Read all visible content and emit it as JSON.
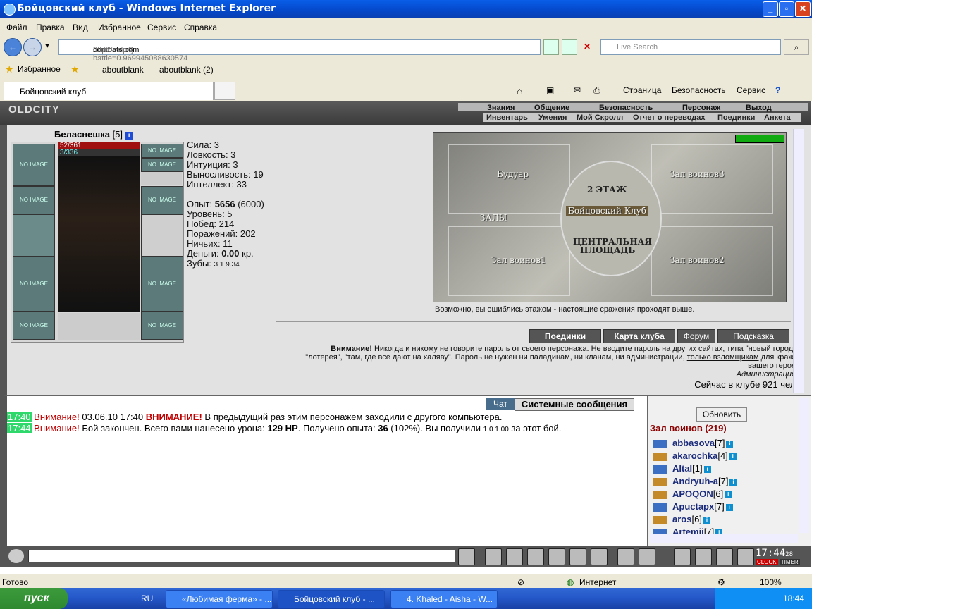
{
  "window": {
    "title": "Бойцовский клуб - Windows Internet Explorer"
  },
  "menu": [
    "Файл",
    "Правка",
    "Вид",
    "Избранное",
    "Сервис",
    "Справка"
  ],
  "address": {
    "prefix": "http://oldcity.",
    "domain": "combats.com",
    "suffix": "/buttons.pl?battle=0.969945088630574",
    "search_placeholder": "Live Search"
  },
  "favorites": {
    "label": "Избранное",
    "links": [
      "aboutblank",
      "aboutblank (2)"
    ]
  },
  "tab": {
    "title": "Бойцовский клуб"
  },
  "command_bar": {
    "page": "Страница",
    "security": "Безопасность",
    "service": "Сервис"
  },
  "game": {
    "logo": "OLDCITY",
    "top_menu": [
      "Знания",
      "Общение",
      "Безопасность",
      "Персонаж",
      "Выход"
    ],
    "sub_menu": [
      "Инвентарь",
      "Умения",
      "Мой Скролл",
      "Отчет о переводах",
      "Поединки",
      "Анкета"
    ],
    "player": {
      "name": "Беласнешка",
      "level": "[5]",
      "hp": "52/361",
      "mp": "3/336",
      "no_image": "NO IMAGE"
    },
    "stats": {
      "strength": "Сила: 3",
      "agility": "Ловкость: 3",
      "intuition": "Интуиция: 3",
      "endurance": "Выносливость: 19",
      "intellect": "Интеллект: 33",
      "exp_label": "Опыт: ",
      "exp_value": "5656",
      "exp_next": " (6000)",
      "level": "Уровень: 5",
      "wins": "Побед: 214",
      "losses": "Поражений: 202",
      "draws": "Ничьих: 11",
      "money_label": "Деньги: ",
      "money_value": "0.00",
      "money_unit": " кр.",
      "teeth_label": "Зубы: ",
      "teeth_values": "3  1  9.34"
    },
    "map": {
      "rooms": [
        "Будуар",
        "Зал воинов3",
        "2 ЭТАЖ",
        "Бойцовский Клуб",
        "ЗАЛЫ",
        "Зал воинов1",
        "Зал воинов2"
      ],
      "central_1": "ЦЕНТРАЛЬНАЯ",
      "central_2": "ПЛОЩАДЬ",
      "note": "Возможно, вы ошиблись этажом - настоящие сражения проходят выше."
    },
    "buttons": [
      "Поединки",
      "Карта клуба",
      "Форум",
      "Подсказка"
    ],
    "warning": {
      "bold": "Внимание!",
      "text": " Никогда и никому не говорите пароль от своего персонажа. Не вводите пароль на других сайтах, типа \"новый город\", \"лотерея\", \"там, где все дают на халяву\". Пароль не нужен ни паладинам, ни кланам, ни администрации, ",
      "link": "только взломщикам",
      "tail": " для кражи вашего героя.",
      "sign": "Администрация."
    },
    "online": "Сейчас в клубе 921 чел."
  },
  "chat": {
    "tabs": [
      "Чат",
      "Системные сообщения"
    ],
    "messages": [
      {
        "time": "17:40",
        "prefix": "Внимание!",
        "text1": " 03.06.10 17:40 ",
        "bold": "ВНИМАНИЕ!",
        "text2": " В предыдущий раз этим персонажем заходили с другого компьютера."
      },
      {
        "time": "17:44",
        "prefix": "Внимание!",
        "text1": " Бой закончен. Всего вами нанесено урона: ",
        "dmg": "129 HP",
        "text2": ". Получено опыта: ",
        "exp": "36",
        "text3": " (102%). Вы получили ",
        "reward": "1  0  1.00",
        "text4": " за этот бой."
      }
    ]
  },
  "users": {
    "refresh": "Обновить",
    "room": "Зал воинов (219)",
    "list": [
      {
        "name": "abbasova",
        "lvl": "[7]"
      },
      {
        "name": "akarochka",
        "lvl": "[4]"
      },
      {
        "name": "Altal",
        "lvl": "[1]"
      },
      {
        "name": "Andryuh-a",
        "lvl": "[7]"
      },
      {
        "name": "APOQON",
        "lvl": "[6]"
      },
      {
        "name": "Apuctapx",
        "lvl": "[7]"
      },
      {
        "name": "aros",
        "lvl": "[6]"
      },
      {
        "name": "Artemii",
        "lvl": "[7]"
      }
    ]
  },
  "clock": {
    "time": "17:44",
    "sec": "28",
    "tab1": "CLOCK",
    "tab2": "TIMER"
  },
  "status": {
    "left": "Готово",
    "zone": "Интернет",
    "zoom": "100%"
  },
  "taskbar": {
    "start": "пуск",
    "lang": "RU",
    "tasks": [
      "«Любимая ферма» - ...",
      "Бойцовский клуб - ...",
      "4. Khaled - Aisha - W..."
    ],
    "time": "18:44"
  }
}
